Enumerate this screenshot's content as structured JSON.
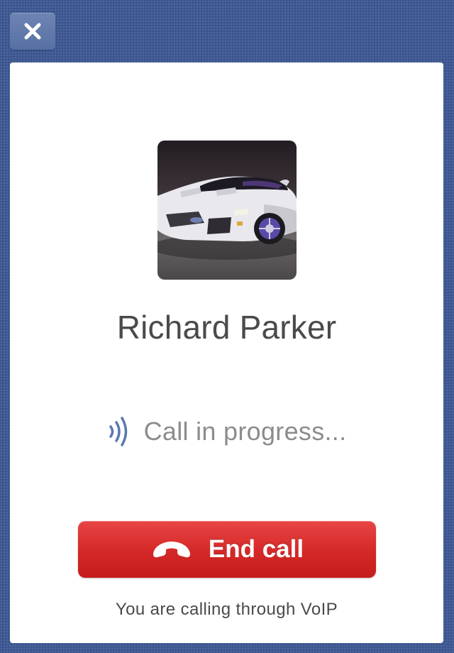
{
  "toolbar": {
    "close_icon": "close-icon"
  },
  "contact": {
    "name": "Richard Parker",
    "avatar_icon": "contact-photo-sports-car"
  },
  "call": {
    "status_icon": "call-signal-icon",
    "status_text": "Call in progress...",
    "end_icon": "phone-hangup-icon",
    "end_label": "End call",
    "note": "You are calling through VoIP"
  },
  "colors": {
    "background": "#3f5a95",
    "end_call_red": "#d62a2a",
    "signal_blue": "#5b78b0",
    "card": "#ffffff"
  }
}
